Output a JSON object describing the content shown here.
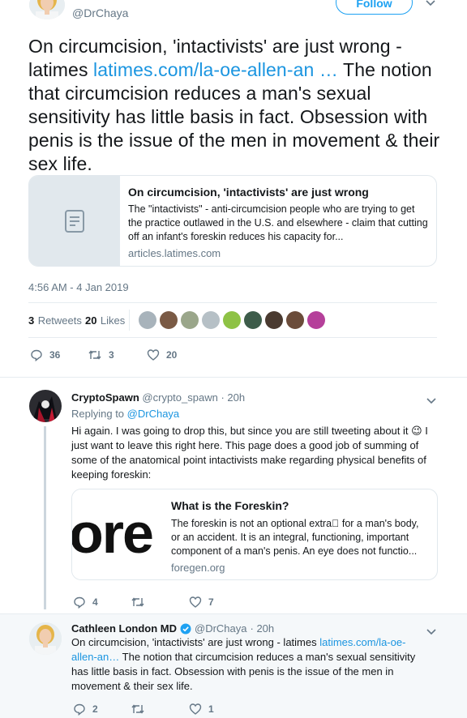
{
  "header": {
    "handle": "@DrChaya",
    "follow_label": "Follow"
  },
  "main_tweet": {
    "text_before_link": "On circumcision, 'intactivists' are just wrong - latimes ",
    "link_text": "latimes.com/la-oe-allen-an …",
    "text_after_link": " The notion that circumcision reduces a man's sexual sensitivity has little basis in fact. Obsession with penis is the issue of the men in movement & their sex life.",
    "card": {
      "title": "On circumcision, 'intactivists' are just wrong",
      "description": "The \"intactivists\" - anti-circumcision people who are trying to get the practice outlawed in the U.S. and elsewhere - claim that cutting off an infant's foreskin reduces his capacity for...",
      "domain": "articles.latimes.com",
      "icon": "document-icon"
    },
    "timestamp": "4:56 AM - 4 Jan 2019",
    "retweets_count": "3",
    "retweets_label": "Retweets",
    "likes_count": "20",
    "likes_label": "Likes",
    "liker_avatar_colors": [
      "#a8b3bb",
      "#7a5a45",
      "#9aa68a",
      "#b6c0c6",
      "#8ec245",
      "#3d5c4a",
      "#4a3a30",
      "#6b4c3a",
      "#b5409a"
    ],
    "actions": {
      "replies": "36",
      "retweets": "3",
      "likes": "20"
    }
  },
  "reply1": {
    "name": "CryptoSpawn",
    "handle": "@crypto_spawn",
    "time": "· 20h",
    "replying_to_label": "Replying to",
    "replying_to_handle": "@DrChaya",
    "text": "Hi again. I was going to drop this, but since you are still tweeting about it 😉 I just want to leave this right here. This page does a good job of summing of some of the anatomical point intactivists make regarding physical benefits of keeping foreskin:",
    "card": {
      "image_text": "ore",
      "title": "What is the Foreskin?",
      "description": "The foreskin is not an optional extra⃞ for a man's body, or an accident. It is an integral, functioning, important component of a man's penis. An eye does not functio...",
      "domain": "foregen.org"
    },
    "actions": {
      "replies": "4",
      "retweets": "",
      "likes": "7"
    }
  },
  "reply2": {
    "name": "Cathleen London MD",
    "verified_icon": "verified-badge-icon",
    "handle": "@DrChaya",
    "time": "· 20h",
    "text_before_link": "On circumcision, 'intactivists' are just wrong - latimes ",
    "link_text": "latimes.com/la-oe-allen-an…",
    "text_after_link": " The notion that circumcision reduces a man's sexual sensitivity has little basis in fact. Obsession with penis is the issue of the men in movement & their sex life.",
    "actions": {
      "replies": "2",
      "retweets": "",
      "likes": "1"
    }
  },
  "colors": {
    "link": "#1b95e0",
    "muted": "#657786",
    "highlight_bg": "#f5f8fa",
    "like_pink": "#e0245e"
  }
}
